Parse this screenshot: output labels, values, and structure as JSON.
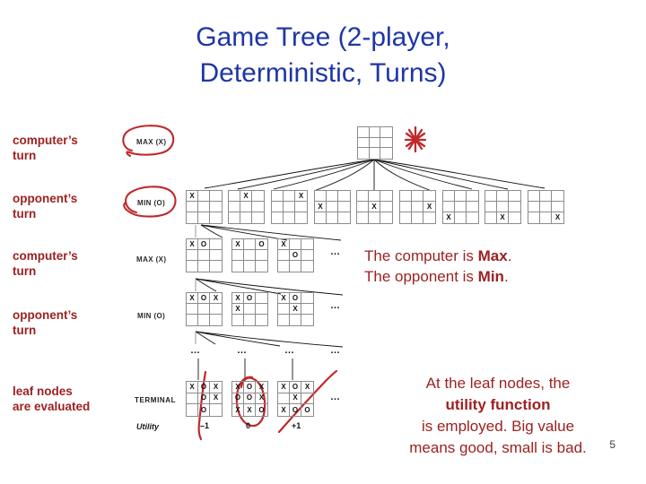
{
  "slide": {
    "title_line1": "Game Tree (2-player,",
    "title_line2": "Deterministic, Turns)",
    "title_color": "#1F36A8",
    "accent_color": "#9C2122",
    "ink_color": "#C0282C",
    "page_number": "5"
  },
  "row_labels": [
    {
      "line1": "computer’s",
      "line2": "turn"
    },
    {
      "line1": "opponent’s",
      "line2": "turn"
    },
    {
      "line1": "computer’s",
      "line2": "turn"
    },
    {
      "line1": "opponent’s",
      "line2": "turn"
    },
    {
      "line1": "leaf nodes",
      "line2": "are evaluated"
    }
  ],
  "ply_labels": {
    "max_1": "MAX (X)",
    "min_1": "MIN (O)",
    "max_2": "MAX (X)",
    "min_2": "MIN (O)",
    "terminal": "TERMINAL",
    "utility": "Utility"
  },
  "notes": {
    "max_min_line1_a": "The computer is ",
    "max_min_line1_b": "Max",
    "max_min_line1_c": ".",
    "max_min_line2_a": "The opponent is ",
    "max_min_line2_b": "Min",
    "max_min_line2_c": ".",
    "leaf_line1": "At the leaf nodes, the",
    "leaf_line2": "utility function",
    "leaf_line3": "is employed. Big value",
    "leaf_line4": "means good, small is bad."
  },
  "ellipses": {
    "dots": "…"
  },
  "tree": {
    "root": {
      "cells": [
        "",
        "",
        "",
        "",
        "",
        "",
        "",
        "",
        ""
      ]
    },
    "level1": [
      {
        "cells": [
          "X",
          "",
          "",
          "",
          "",
          "",
          "",
          "",
          ""
        ]
      },
      {
        "cells": [
          "",
          "X",
          "",
          "",
          "",
          "",
          "",
          "",
          ""
        ]
      },
      {
        "cells": [
          "",
          "",
          "X",
          "",
          "",
          "",
          "",
          "",
          ""
        ]
      },
      {
        "cells": [
          "",
          "",
          "",
          "X",
          "",
          "",
          "",
          "",
          ""
        ]
      },
      {
        "cells": [
          "",
          "",
          "",
          "",
          "X",
          "",
          "",
          "",
          ""
        ]
      },
      {
        "cells": [
          "",
          "",
          "",
          "",
          "",
          "X",
          "",
          "",
          ""
        ]
      },
      {
        "cells": [
          "",
          "",
          "",
          "",
          "",
          "",
          "X",
          "",
          ""
        ]
      },
      {
        "cells": [
          "",
          "",
          "",
          "",
          "",
          "",
          "",
          "X",
          ""
        ]
      },
      {
        "cells": [
          "",
          "",
          "",
          "",
          "",
          "",
          "",
          "",
          "X"
        ]
      }
    ],
    "level2": [
      {
        "cells": [
          "X",
          "O",
          "",
          "",
          "",
          "",
          "",
          "",
          ""
        ]
      },
      {
        "cells": [
          "X",
          "",
          "O",
          "",
          "",
          "",
          "",
          "",
          ""
        ]
      },
      {
        "cells": [
          "X",
          "",
          "",
          "",
          "O",
          "",
          "",
          "",
          ""
        ]
      }
    ],
    "level3": [
      {
        "cells": [
          "X",
          "O",
          "X",
          "",
          "",
          "",
          "",
          "",
          ""
        ]
      },
      {
        "cells": [
          "X",
          "O",
          "",
          "X",
          "",
          "",
          "",
          "",
          ""
        ]
      },
      {
        "cells": [
          "X",
          "O",
          "",
          "",
          "X",
          "",
          "",
          "",
          ""
        ]
      }
    ],
    "leaves": [
      {
        "cells": [
          "X",
          "O",
          "X",
          "",
          "O",
          "X",
          "",
          "O",
          ""
        ],
        "value": "–1"
      },
      {
        "cells": [
          "X",
          "O",
          "X",
          "O",
          "O",
          "X",
          "X",
          "X",
          "O"
        ],
        "value": "0"
      },
      {
        "cells": [
          "X",
          "O",
          "X",
          "",
          "X",
          "",
          "X",
          "O",
          "O"
        ],
        "value": "+1"
      }
    ]
  }
}
